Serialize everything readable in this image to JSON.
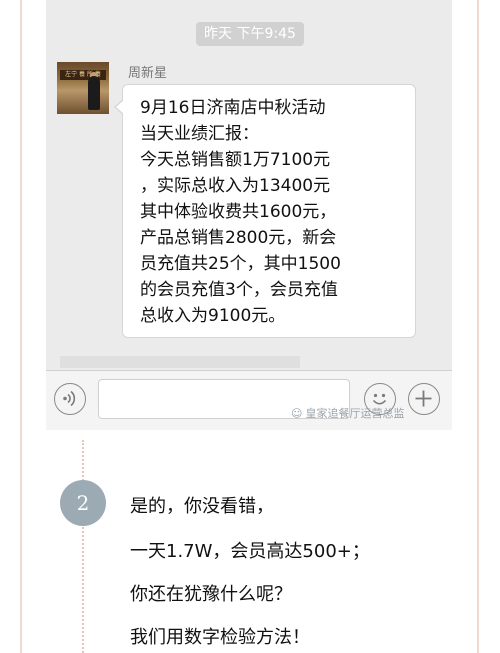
{
  "chat": {
    "timestamp": "昨天 下午9:45",
    "sender_name": "周新星",
    "avatar_banner_text": "左宁 養 所 養",
    "message_lines": [
      "9月16日济南店中秋活动",
      "当天业绩汇报：",
      "今天总销售额1万7100元",
      "，实际总收入为13400元",
      "其中体验收费共1600元，",
      "产品总销售2800元，新会",
      "员充值共25个，其中1500",
      "的会员充值3个，会员充值",
      "总收入为9100元。"
    ],
    "input_value": "",
    "watermark_text": "皇家追餐厅运营总监"
  },
  "icons": {
    "voice": "voice-icon",
    "emoji": "emoji-icon",
    "plus": "plus-icon",
    "wechat": "wechat-icon"
  },
  "article": {
    "step_number": "2",
    "lines": [
      "是的，你没看错，",
      "一天1.7W，会员高达500+；",
      "你还在犹豫什么呢？",
      "我们用数字检验方法！"
    ]
  },
  "colors": {
    "chat_bg": "#ebebeb",
    "badge": "#9caab4",
    "rule": "#f0d9d0"
  }
}
